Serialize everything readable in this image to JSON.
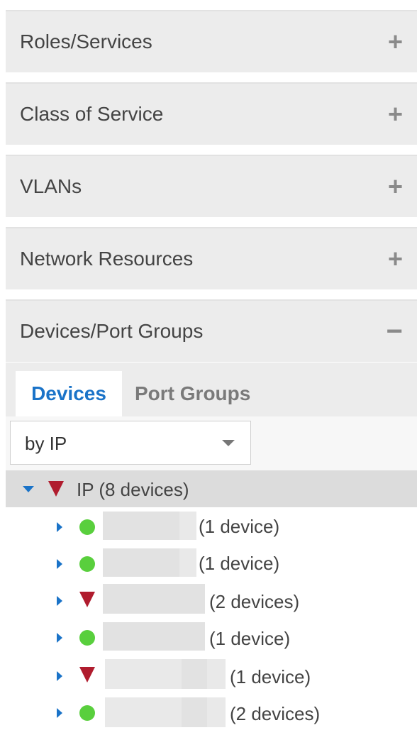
{
  "panels": [
    {
      "title": "Roles/Services",
      "toggle": "+"
    },
    {
      "title": "Class of Service",
      "toggle": "+"
    },
    {
      "title": "VLANs",
      "toggle": "+"
    },
    {
      "title": "Network Resources",
      "toggle": "+"
    },
    {
      "title": "Devices/Port Groups",
      "toggle": "−"
    }
  ],
  "tabs": {
    "devices": "Devices",
    "port_groups": "Port Groups"
  },
  "filter": {
    "selected": "by IP"
  },
  "group": {
    "label": "IP (8 devices)",
    "status": "critical"
  },
  "items": [
    {
      "status": "ok",
      "count": "(1 device)"
    },
    {
      "status": "ok",
      "count": "(1 device)"
    },
    {
      "status": "critical",
      "count": "(2 devices)"
    },
    {
      "status": "ok",
      "count": "(1 device)"
    },
    {
      "status": "critical",
      "count": "(1 device)"
    },
    {
      "status": "ok",
      "count": "(2 devices)"
    }
  ],
  "colors": {
    "accent_blue": "#1a73c8",
    "status_ok": "#59cf3d",
    "status_critical": "#b01c2e"
  }
}
